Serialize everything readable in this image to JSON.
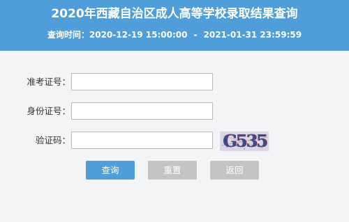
{
  "header": {
    "title": "2020年西藏自治区成人高等学校录取结果查询",
    "query_time_label": "查询时间：",
    "start_time": "2020-12-19 15:00:00",
    "separator": "-",
    "end_time": "2021-01-31 23:59:59"
  },
  "form": {
    "exam_number_label": "准考证号：",
    "exam_number_value": "",
    "id_number_label": "身份证号：",
    "id_number_value": "",
    "captcha_label": "验证码：",
    "captcha_value": "",
    "captcha_image_text": "G535"
  },
  "buttons": {
    "query": "查询",
    "reset": "重置",
    "back": "返回"
  },
  "colors": {
    "header_bg": "#4f9ed9",
    "page_bg": "#f3f4f6",
    "primary_button": "#4f9ed9",
    "secondary_button": "#c4c4c4"
  }
}
